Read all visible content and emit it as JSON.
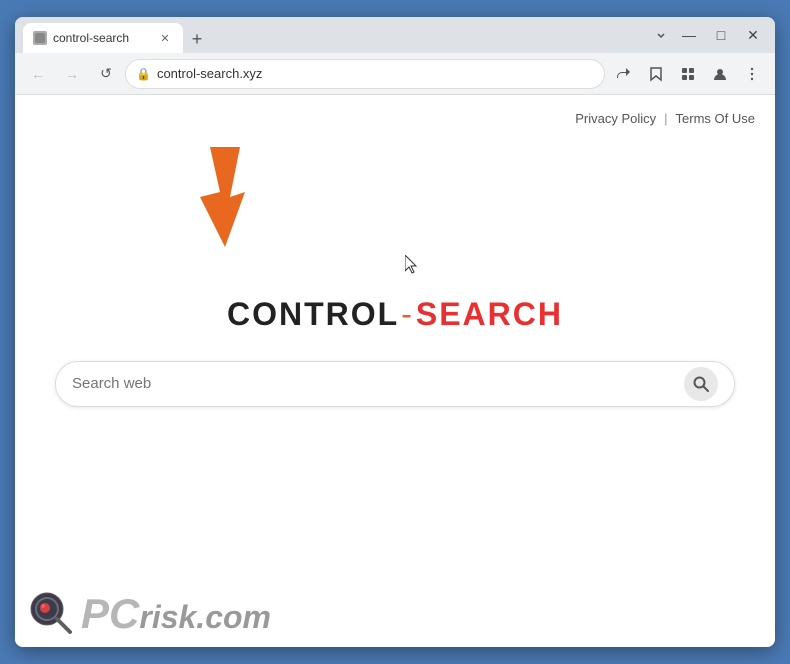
{
  "browser": {
    "tab_title": "control-search",
    "url": "control-search.xyz",
    "window_controls": {
      "minimize": "—",
      "maximize": "□",
      "close": "✕"
    },
    "nav": {
      "back_label": "←",
      "forward_label": "→",
      "reload_label": "↺"
    }
  },
  "page": {
    "privacy_policy_label": "Privacy Policy",
    "divider": "|",
    "terms_of_use_label": "Terms Of Use",
    "logo_control": "CONTROL",
    "logo_dash": "-",
    "logo_search": "SEARCH",
    "search_placeholder": "Search web"
  },
  "watermark": {
    "pc_text": "PC",
    "risk_text": "risk.com"
  }
}
